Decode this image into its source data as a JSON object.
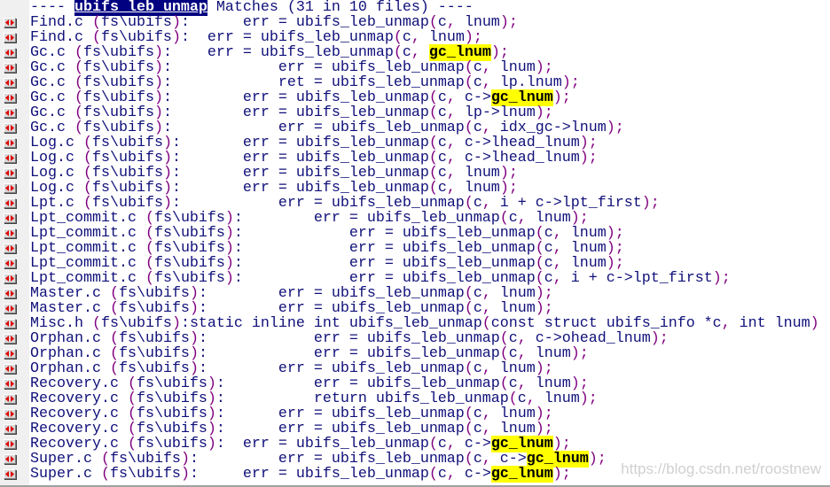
{
  "header": {
    "prefix": "---- ",
    "term": "ubifs_leb_unmap",
    "suffix": " Matches (31 in 10 files) ----"
  },
  "highlight_term": "gc_lnum",
  "row_icon": "jump-to-match-icon",
  "colors": {
    "text": "#10107a",
    "punctuation": "#800080",
    "highlight": "#ffff00",
    "header_highlight": "#000080"
  },
  "rows": [
    {
      "location": "Find.c (fs\\ubifs):",
      "code": "      err = ubifs_leb_unmap(c, lnum);"
    },
    {
      "location": "Find.c (fs\\ubifs):",
      "code": "  err = ubifs_leb_unmap(c, lnum);"
    },
    {
      "location": "Gc.c (fs\\ubifs):",
      "code": "    err = ubifs_leb_unmap(c, gc_lnum);"
    },
    {
      "location": "Gc.c (fs\\ubifs):",
      "code": "            err = ubifs_leb_unmap(c, lnum);"
    },
    {
      "location": "Gc.c (fs\\ubifs):",
      "code": "            ret = ubifs_leb_unmap(c, lp.lnum);"
    },
    {
      "location": "Gc.c (fs\\ubifs):",
      "code": "        err = ubifs_leb_unmap(c, c->gc_lnum);"
    },
    {
      "location": "Gc.c (fs\\ubifs):",
      "code": "        err = ubifs_leb_unmap(c, lp->lnum);"
    },
    {
      "location": "Gc.c (fs\\ubifs):",
      "code": "            err = ubifs_leb_unmap(c, idx_gc->lnum);"
    },
    {
      "location": "Log.c (fs\\ubifs):",
      "code": "       err = ubifs_leb_unmap(c, c->lhead_lnum);"
    },
    {
      "location": "Log.c (fs\\ubifs):",
      "code": "       err = ubifs_leb_unmap(c, c->lhead_lnum);"
    },
    {
      "location": "Log.c (fs\\ubifs):",
      "code": "       err = ubifs_leb_unmap(c, lnum);"
    },
    {
      "location": "Log.c (fs\\ubifs):",
      "code": "       err = ubifs_leb_unmap(c, lnum);"
    },
    {
      "location": "Lpt.c (fs\\ubifs):",
      "code": "           err = ubifs_leb_unmap(c, i + c->lpt_first);"
    },
    {
      "location": "Lpt_commit.c (fs\\ubifs):",
      "code": "        err = ubifs_leb_unmap(c, lnum);"
    },
    {
      "location": "Lpt_commit.c (fs\\ubifs):",
      "code": "            err = ubifs_leb_unmap(c, lnum);"
    },
    {
      "location": "Lpt_commit.c (fs\\ubifs):",
      "code": "            err = ubifs_leb_unmap(c, lnum);"
    },
    {
      "location": "Lpt_commit.c (fs\\ubifs):",
      "code": "            err = ubifs_leb_unmap(c, lnum);"
    },
    {
      "location": "Lpt_commit.c (fs\\ubifs):",
      "code": "            err = ubifs_leb_unmap(c, i + c->lpt_first);"
    },
    {
      "location": "Master.c (fs\\ubifs):",
      "code": "        err = ubifs_leb_unmap(c, lnum);"
    },
    {
      "location": "Master.c (fs\\ubifs):",
      "code": "        err = ubifs_leb_unmap(c, lnum);"
    },
    {
      "location": "Misc.h (fs\\ubifs):",
      "code": "static inline int ubifs_leb_unmap(const struct ubifs_info *c, int lnum)"
    },
    {
      "location": "Orphan.c (fs\\ubifs):",
      "code": "            err = ubifs_leb_unmap(c, c->ohead_lnum);"
    },
    {
      "location": "Orphan.c (fs\\ubifs):",
      "code": "            err = ubifs_leb_unmap(c, lnum);"
    },
    {
      "location": "Orphan.c (fs\\ubifs):",
      "code": "        err = ubifs_leb_unmap(c, lnum);"
    },
    {
      "location": "Recovery.c (fs\\ubifs):",
      "code": "          err = ubifs_leb_unmap(c, lnum);"
    },
    {
      "location": "Recovery.c (fs\\ubifs):",
      "code": "          return ubifs_leb_unmap(c, lnum);"
    },
    {
      "location": "Recovery.c (fs\\ubifs):",
      "code": "      err = ubifs_leb_unmap(c, lnum);"
    },
    {
      "location": "Recovery.c (fs\\ubifs):",
      "code": "      err = ubifs_leb_unmap(c, lnum);"
    },
    {
      "location": "Recovery.c (fs\\ubifs):",
      "code": "  err = ubifs_leb_unmap(c, c->gc_lnum);"
    },
    {
      "location": "Super.c (fs\\ubifs):",
      "code": "         err = ubifs_leb_unmap(c, c->gc_lnum);"
    },
    {
      "location": "Super.c (fs\\ubifs):",
      "code": "     err = ubifs_leb_unmap(c, c->gc_lnum);"
    }
  ],
  "watermark": "https://blog.csdn.net/roostnew"
}
